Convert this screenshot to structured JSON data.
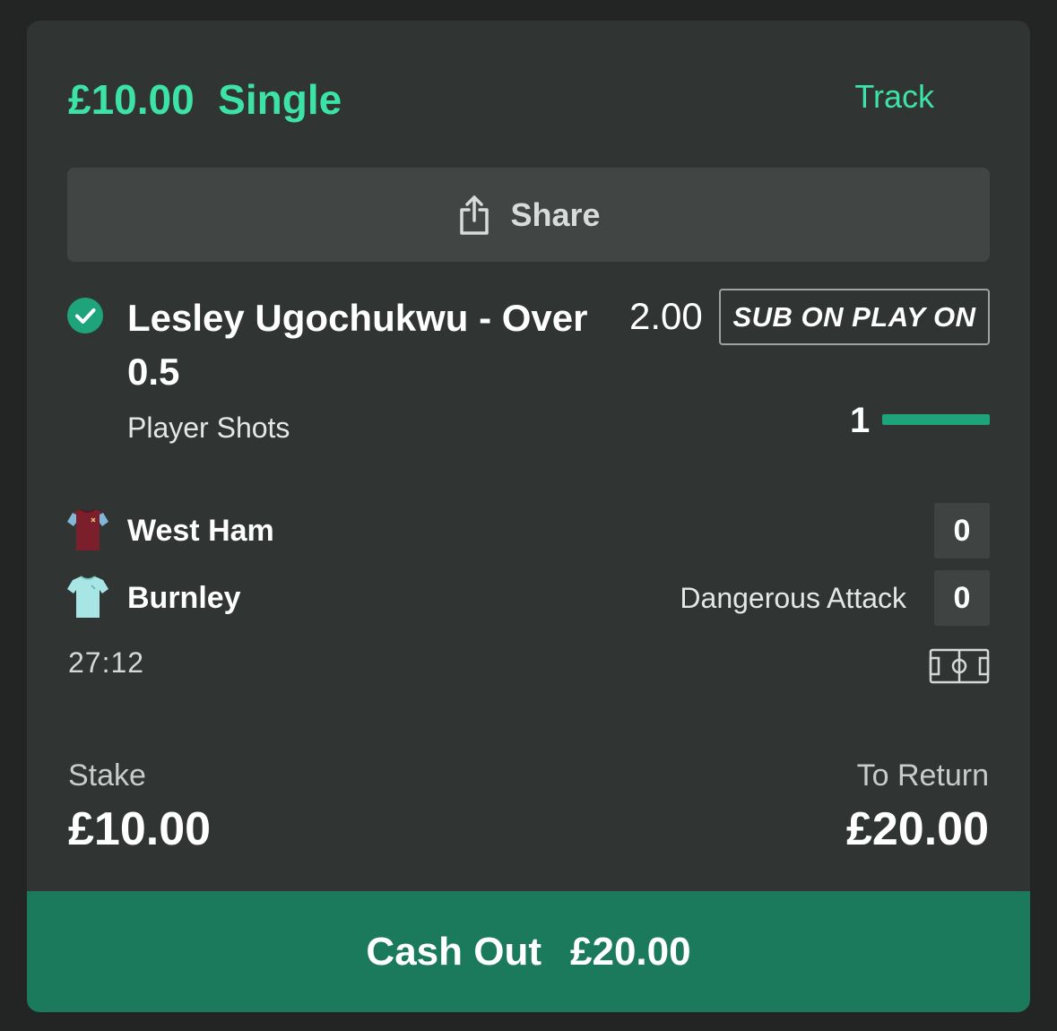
{
  "bet": {
    "amount": "£10.00",
    "type": "Single",
    "track_label": "Track"
  },
  "share": {
    "label": "Share",
    "icon": "share-icon"
  },
  "selection": {
    "name": "Lesley Ugochukwu - Over 0.5",
    "odds": "2.00",
    "promo_badge": "SUB ON PLAY ON",
    "market": "Player Shots",
    "status_icon": "check-circle-icon",
    "progress_count": "1",
    "progress_fraction": 1.0
  },
  "match": {
    "home": {
      "name": "West Ham",
      "score": "0",
      "kit_icon": "west-ham-kit-icon"
    },
    "away": {
      "name": "Burnley",
      "score": "0",
      "kit_icon": "burnley-kit-icon"
    },
    "status": "Dangerous Attack",
    "clock": "27:12",
    "pitch_icon": "pitch-icon"
  },
  "summary": {
    "stake_label": "Stake",
    "stake_value": "£10.00",
    "return_label": "To Return",
    "return_value": "£20.00"
  },
  "cashout": {
    "label": "Cash Out",
    "amount": "£20.00"
  },
  "colors": {
    "accent": "#3de2a6",
    "cashout_bg": "#1b7a5c",
    "card_bg": "#303433",
    "progress": "#1fa37a"
  }
}
